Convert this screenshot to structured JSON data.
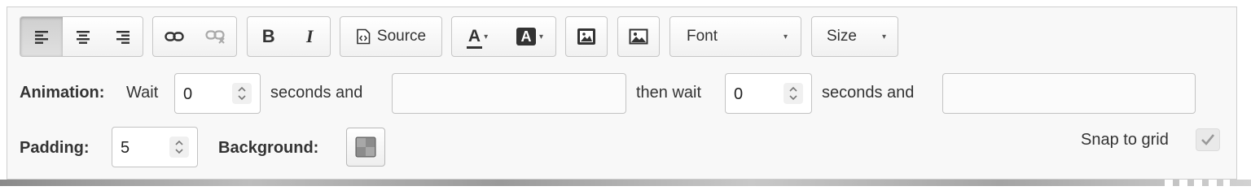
{
  "toolbar": {
    "align_left_icon": "align-left-icon",
    "align_center_icon": "align-center-icon",
    "align_right_icon": "align-right-icon",
    "link_icon": "link-icon",
    "unlink_icon": "unlink-icon",
    "bold_label": "B",
    "italic_label": "I",
    "source_label": "Source",
    "text_color_label": "A",
    "bg_color_label": "A",
    "font_label": "Font",
    "size_label": "Size"
  },
  "animation": {
    "label": "Animation:",
    "wait_label": "Wait",
    "wait_value": "0",
    "seconds_and_1": "seconds and",
    "effect_1_value": "",
    "then_wait_label": "then wait",
    "then_wait_value": "0",
    "seconds_and_2": "seconds and",
    "effect_2_value": ""
  },
  "padding": {
    "label": "Padding:",
    "value": "5"
  },
  "background": {
    "label": "Background:"
  },
  "snap": {
    "label": "Snap to grid",
    "checked": true
  },
  "colors": {
    "active_button_bg": "#d3d3d3",
    "panel_bg": "#f8f8f8"
  }
}
